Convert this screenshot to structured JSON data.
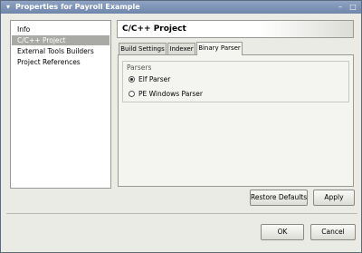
{
  "window": {
    "title": "Properties for Payroll Example",
    "menu_glyph": "▾",
    "minimize_glyph": "–",
    "maximize_glyph": "□"
  },
  "nav": {
    "items": [
      {
        "label": "Info"
      },
      {
        "label": "C/C++ Project",
        "selected": true
      },
      {
        "label": "External Tools Builders"
      },
      {
        "label": "Project References"
      }
    ]
  },
  "page": {
    "title": "C/C++ Project",
    "tabs": [
      {
        "label": "Build Settings"
      },
      {
        "label": "Indexer"
      },
      {
        "label": "Binary Parser",
        "active": true
      }
    ],
    "parsers": {
      "group_label": "Parsers",
      "options": [
        {
          "label": "Elf Parser",
          "selected": true
        },
        {
          "label": "PE Windows Parser",
          "selected": false
        }
      ]
    },
    "restore_defaults_label": "Restore Defaults",
    "apply_label": "Apply"
  },
  "dialog": {
    "ok_label": "OK",
    "cancel_label": "Cancel"
  },
  "colors": {
    "selection": "#a9a9a6",
    "titlebar": "#7f94b8",
    "background": "#ebebe6"
  }
}
